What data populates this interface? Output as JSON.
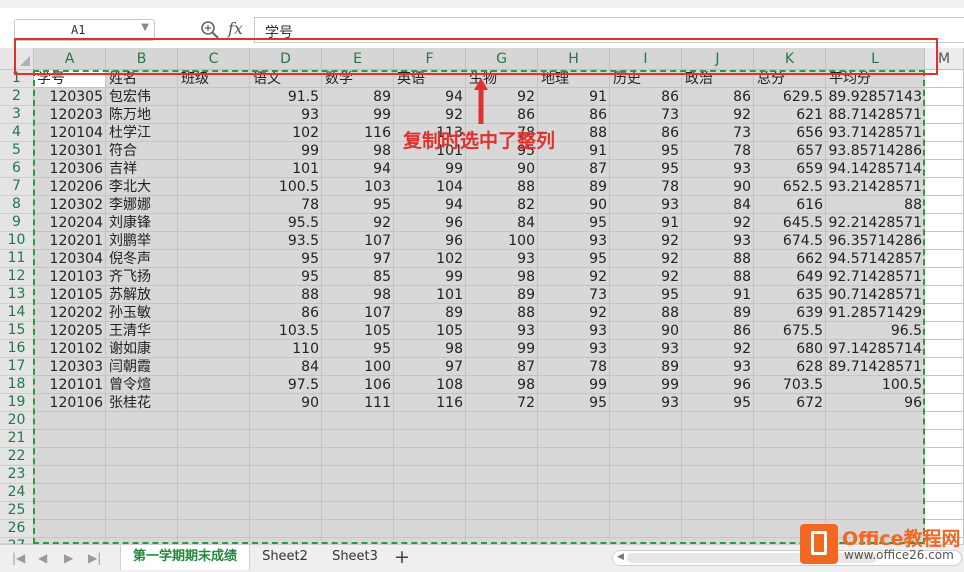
{
  "formula_bar": {
    "name_box": "A1",
    "fx_label": "fx",
    "content": "学号"
  },
  "columns": [
    "A",
    "B",
    "C",
    "D",
    "E",
    "F",
    "G",
    "H",
    "I",
    "J",
    "K",
    "L",
    "M"
  ],
  "row_numbers": [
    "1",
    "2",
    "3",
    "4",
    "5",
    "6",
    "7",
    "8",
    "9",
    "10",
    "11",
    "12",
    "13",
    "14",
    "15",
    "16",
    "17",
    "18",
    "19",
    "20",
    "21",
    "22",
    "23",
    "24",
    "25",
    "26",
    "27"
  ],
  "table": {
    "headers": [
      "学号",
      "姓名",
      "班级",
      "语文",
      "数学",
      "英语",
      "生物",
      "地理",
      "历史",
      "政治",
      "总分",
      "平均分"
    ],
    "rows": [
      [
        "120305",
        "包宏伟",
        "",
        "91.5",
        "89",
        "94",
        "92",
        "91",
        "86",
        "86",
        "629.5",
        "89.92857143"
      ],
      [
        "120203",
        "陈万地",
        "",
        "93",
        "99",
        "92",
        "86",
        "86",
        "73",
        "92",
        "621",
        "88.71428571"
      ],
      [
        "120104",
        "杜学江",
        "",
        "102",
        "116",
        "113",
        "78",
        "88",
        "86",
        "73",
        "656",
        "93.71428571"
      ],
      [
        "120301",
        "符合",
        "",
        "99",
        "98",
        "101",
        "95",
        "91",
        "95",
        "78",
        "657",
        "93.85714286"
      ],
      [
        "120306",
        "吉祥",
        "",
        "101",
        "94",
        "99",
        "90",
        "87",
        "95",
        "93",
        "659",
        "94.14285714"
      ],
      [
        "120206",
        "李北大",
        "",
        "100.5",
        "103",
        "104",
        "88",
        "89",
        "78",
        "90",
        "652.5",
        "93.21428571"
      ],
      [
        "120302",
        "李娜娜",
        "",
        "78",
        "95",
        "94",
        "82",
        "90",
        "93",
        "84",
        "616",
        "88"
      ],
      [
        "120204",
        "刘康锋",
        "",
        "95.5",
        "92",
        "96",
        "84",
        "95",
        "91",
        "92",
        "645.5",
        "92.21428571"
      ],
      [
        "120201",
        "刘鹏举",
        "",
        "93.5",
        "107",
        "96",
        "100",
        "93",
        "92",
        "93",
        "674.5",
        "96.35714286"
      ],
      [
        "120304",
        "倪冬声",
        "",
        "95",
        "97",
        "102",
        "93",
        "95",
        "92",
        "88",
        "662",
        "94.57142857"
      ],
      [
        "120103",
        "齐飞扬",
        "",
        "95",
        "85",
        "99",
        "98",
        "92",
        "92",
        "88",
        "649",
        "92.71428571"
      ],
      [
        "120105",
        "苏解放",
        "",
        "88",
        "98",
        "101",
        "89",
        "73",
        "95",
        "91",
        "635",
        "90.71428571"
      ],
      [
        "120202",
        "孙玉敏",
        "",
        "86",
        "107",
        "89",
        "88",
        "92",
        "88",
        "89",
        "639",
        "91.28571429"
      ],
      [
        "120205",
        "王清华",
        "",
        "103.5",
        "105",
        "105",
        "93",
        "93",
        "90",
        "86",
        "675.5",
        "96.5"
      ],
      [
        "120102",
        "谢如康",
        "",
        "110",
        "95",
        "98",
        "99",
        "93",
        "93",
        "92",
        "680",
        "97.14285714"
      ],
      [
        "120303",
        "闫朝霞",
        "",
        "84",
        "100",
        "97",
        "87",
        "78",
        "89",
        "93",
        "628",
        "89.71428571"
      ],
      [
        "120101",
        "曾令煊",
        "",
        "97.5",
        "106",
        "108",
        "98",
        "99",
        "99",
        "96",
        "703.5",
        "100.5"
      ],
      [
        "120106",
        "张桂花",
        "",
        "90",
        "111",
        "116",
        "72",
        "95",
        "93",
        "95",
        "672",
        "96"
      ]
    ]
  },
  "annotation": {
    "text": "复制时选中了整列"
  },
  "sheet_tabs": [
    {
      "label": "第一学期期末成绩",
      "active": true
    },
    {
      "label": "Sheet2",
      "active": false
    },
    {
      "label": "Sheet3",
      "active": false
    }
  ],
  "add_sheet_label": "+",
  "watermark": {
    "title": "Office教程网",
    "url": "www.office26.com"
  },
  "colors": {
    "header_green": "#1f7a45",
    "marching_ants": "#2e9a3e",
    "annotation_red": "#e0302f",
    "selection_gray": "#d8d8d8",
    "brand_orange": "#f26722"
  }
}
